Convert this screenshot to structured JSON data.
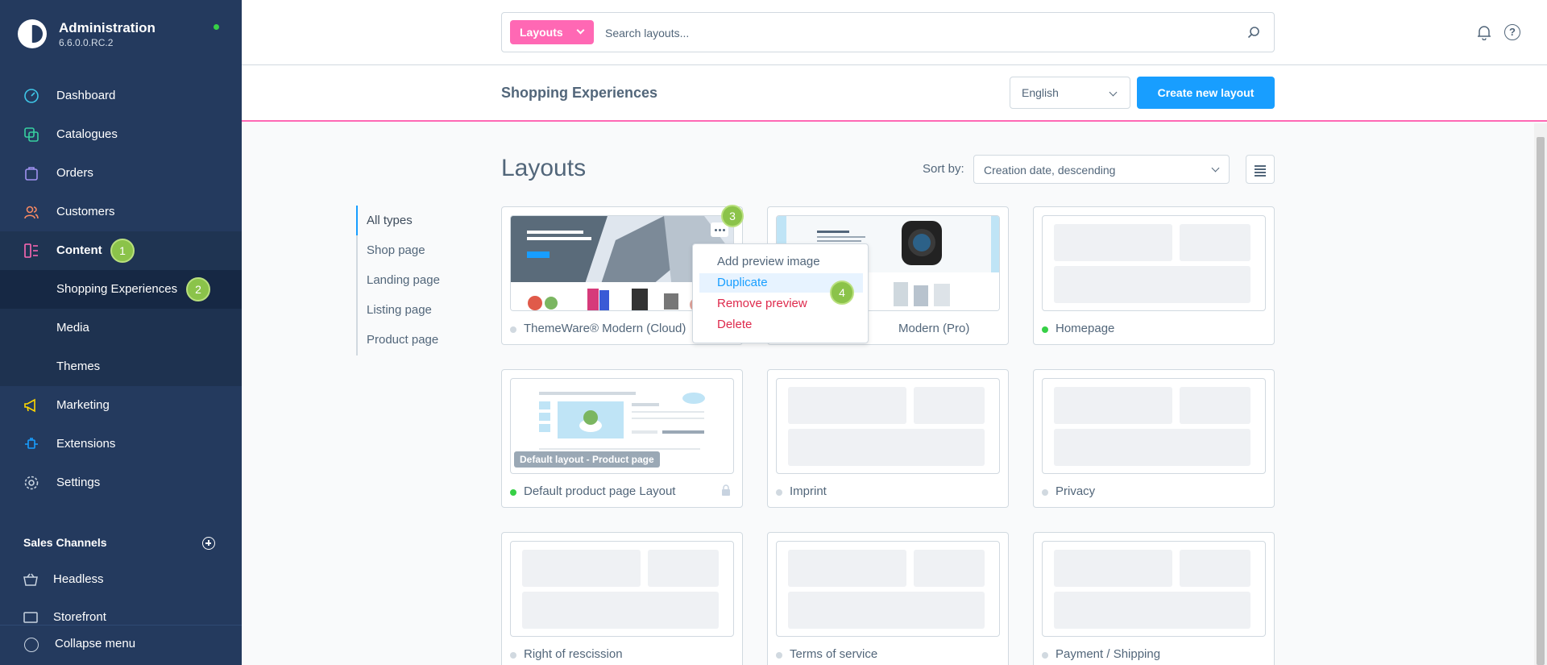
{
  "app": {
    "title": "Administration",
    "version": "6.6.0.0.RC.2"
  },
  "nav": {
    "dashboard": "Dashboard",
    "catalogues": "Catalogues",
    "orders": "Orders",
    "customers": "Customers",
    "content": "Content",
    "shopping_experiences": "Shopping Experiences",
    "media": "Media",
    "themes": "Themes",
    "marketing": "Marketing",
    "extensions": "Extensions",
    "settings": "Settings"
  },
  "badges": {
    "b1": "1",
    "b2": "2",
    "b3": "3",
    "b4": "4"
  },
  "sales_channels": {
    "title": "Sales Channels",
    "items": [
      "Headless",
      "Storefront"
    ]
  },
  "collapse_label": "Collapse menu",
  "search": {
    "type_label": "Layouts",
    "placeholder": "Search layouts..."
  },
  "smartbar": {
    "title": "Shopping Experiences",
    "language": "English",
    "create_label": "Create new layout"
  },
  "content": {
    "heading": "Layouts",
    "sort_label": "Sort by:",
    "sort_value": "Creation date, descending",
    "types": [
      "All types",
      "Shop page",
      "Landing page",
      "Listing page",
      "Product page"
    ]
  },
  "cards": [
    {
      "name": "ThemeWare® Modern (Cloud)",
      "active": false
    },
    {
      "name": "ThemeWare® Modern (Pro)",
      "name_visible": "Modern (Pro)",
      "active": false
    },
    {
      "name": "Homepage",
      "active": true
    },
    {
      "name": "Default product page Layout",
      "active": true,
      "pill": "Default layout - Product page"
    },
    {
      "name": "Imprint",
      "active": false
    },
    {
      "name": "Privacy",
      "active": false
    },
    {
      "name": "Right of rescission",
      "active": false
    },
    {
      "name": "Terms of service",
      "active": false
    },
    {
      "name": "Payment / Shipping",
      "active": false
    }
  ],
  "context_menu": [
    "Add preview image",
    "Duplicate",
    "Remove preview",
    "Delete"
  ],
  "colors": {
    "sidebar": "#243a5e",
    "accent": "#189eff",
    "pink": "#ff68b4",
    "badge": "#8bc34a",
    "active_dot": "#37d046",
    "danger": "#de294c"
  }
}
